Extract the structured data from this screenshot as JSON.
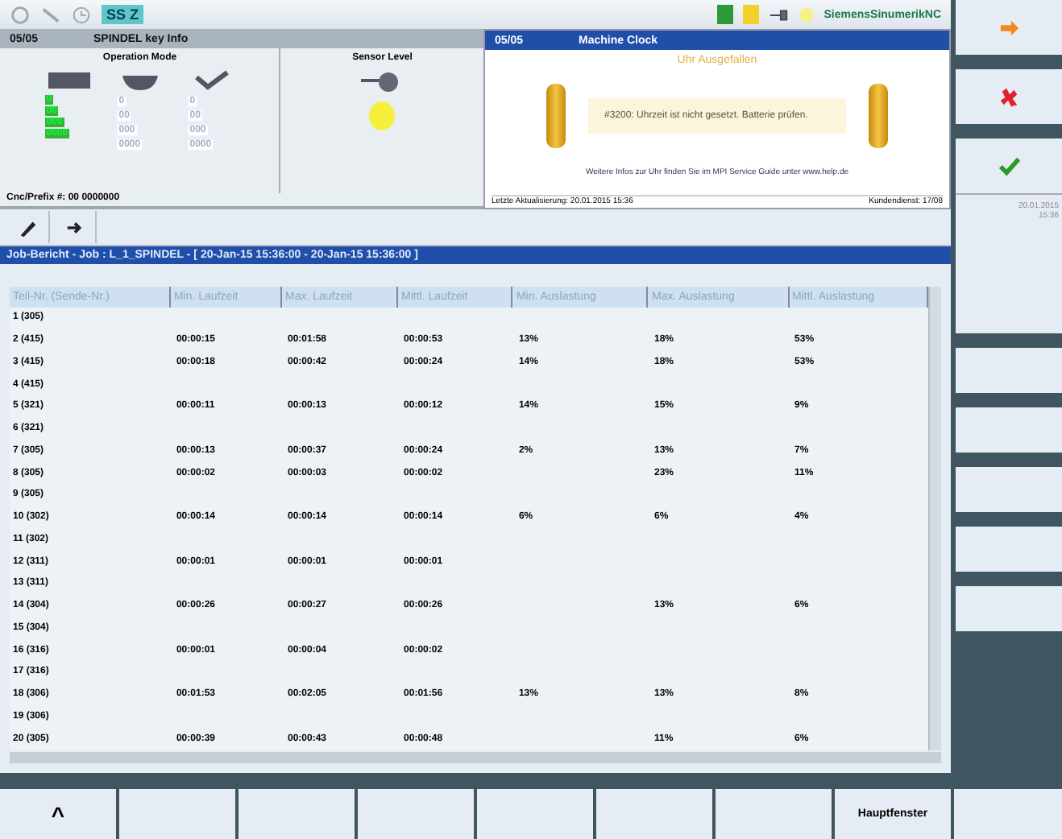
{
  "status_bar": {
    "mode_badge": "SS Z",
    "channel": "SiemensSinumerikNC"
  },
  "spindle_panel": {
    "id": "05/05",
    "title": "SPINDEL key Info",
    "section_1": "Operation Mode",
    "section_2": "Sensor Level",
    "counters": [
      {
        "values": [
          "0",
          "00",
          "000",
          "0000"
        ],
        "active": true
      },
      {
        "values": [
          "0",
          "00",
          "000",
          "0000"
        ],
        "active": false
      },
      {
        "values": [
          "0",
          "00",
          "000",
          "0000"
        ],
        "active": false
      }
    ],
    "footer": "Cnc/Prefix #: 00 0000000"
  },
  "clock_dialog": {
    "id": "05/05",
    "title": "Machine Clock",
    "heading": "Uhr Ausgefallen",
    "message": "#3200: Uhrzeit ist nicht gesetzt. Batterie prüfen.",
    "note": "Weitere Infos zur Uhr finden Sie im MPI Service Guide unter www.help.de",
    "status_left": "Letzte Aktualisierung: 20.01.2015  15:36",
    "status_right": "Kundendienst: 17/08"
  },
  "toolbar": {
    "date": "20.01.2015",
    "time": "15:36"
  },
  "report": {
    "title": "Job-Bericht - Job : L_1_SPINDEL - [ 20-Jan-15 15:36:00 - 20-Jan-15 15:36:00 ]",
    "columns": [
      "Teil-Nr. (Sende-Nr.)",
      "Min. Laufzeit",
      "Max. Laufzeit",
      "Mittl. Laufzeit",
      "Min. Auslastung",
      "Max. Auslastung",
      "Mittl. Auslastung"
    ],
    "rows": [
      [
        "1 (305)",
        "",
        "",
        "",
        "",
        "",
        ""
      ],
      [
        "2 (415)",
        "00:00:15",
        "00:01:58",
        "00:00:53",
        "13%",
        "18%",
        "53%"
      ],
      [
        "3 (415)",
        "00:00:18",
        "00:00:42",
        "00:00:24",
        "14%",
        "18%",
        "53%"
      ],
      [
        "4 (415)",
        "",
        "",
        "",
        "",
        "",
        ""
      ],
      [
        "5 (321)",
        "00:00:11",
        "00:00:13",
        "00:00:12",
        "14%",
        "15%",
        "9%"
      ],
      [
        "6 (321)",
        "",
        "",
        "",
        "",
        "",
        ""
      ],
      [
        "7 (305)",
        "00:00:13",
        "00:00:37",
        "00:00:24",
        "2%",
        "13%",
        "7%"
      ],
      [
        "8 (305)",
        "00:00:02",
        "00:00:03",
        "00:00:02",
        "",
        "23%",
        "11%"
      ],
      [
        "9 (305)",
        "",
        "",
        "",
        "",
        "",
        ""
      ],
      [
        "10 (302)",
        "00:00:14",
        "00:00:14",
        "00:00:14",
        "6%",
        "6%",
        "4%"
      ],
      [
        "11 (302)",
        "",
        "",
        "",
        "",
        "",
        ""
      ],
      [
        "12 (311)",
        "00:00:01",
        "00:00:01",
        "00:00:01",
        "",
        "",
        ""
      ],
      [
        "13 (311)",
        "",
        "",
        "",
        "",
        "",
        ""
      ],
      [
        "14 (304)",
        "00:00:26",
        "00:00:27",
        "00:00:26",
        "",
        "13%",
        "6%"
      ],
      [
        "15 (304)",
        "",
        "",
        "",
        "",
        "",
        ""
      ],
      [
        "16 (316)",
        "00:00:01",
        "00:00:04",
        "00:00:02",
        "",
        "",
        ""
      ],
      [
        "17 (316)",
        "",
        "",
        "",
        "",
        "",
        ""
      ],
      [
        "18 (306)",
        "00:01:53",
        "00:02:05",
        "00:01:56",
        "13%",
        "13%",
        "8%"
      ],
      [
        "19 (306)",
        "",
        "",
        "",
        "",
        "",
        ""
      ],
      [
        "20 (305)",
        "00:00:39",
        "00:00:43",
        "00:00:48",
        "",
        "11%",
        "6%"
      ]
    ]
  },
  "softkeys": [
    {
      "kind": "up",
      "label": "^"
    },
    {
      "kind": "blank"
    },
    {
      "kind": "blank"
    },
    {
      "kind": "blank"
    },
    {
      "kind": "blank"
    },
    {
      "kind": "blank"
    },
    {
      "kind": "blank"
    },
    {
      "kind": "text",
      "label": "Hauptfenster"
    }
  ]
}
